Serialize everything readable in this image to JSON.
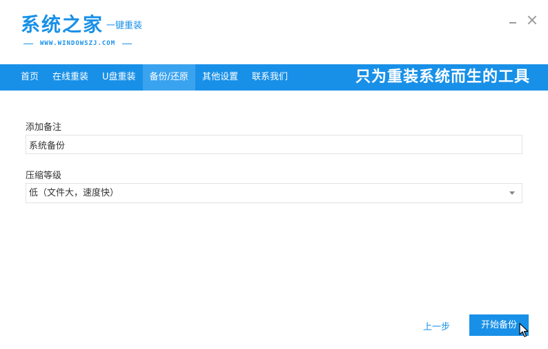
{
  "header": {
    "logo_main": "系统之家",
    "logo_sub": "一键重装",
    "logo_url": "WWW.WINDOWSZJ.COM"
  },
  "nav": {
    "items": [
      {
        "label": "首页"
      },
      {
        "label": "在线重装"
      },
      {
        "label": "U盘重装"
      },
      {
        "label": "备份/还原",
        "active": true
      },
      {
        "label": "其他设置"
      },
      {
        "label": "联系我们"
      }
    ],
    "slogan": "只为重装系统而生的工具"
  },
  "form": {
    "note_label": "添加备注",
    "note_value": "系统备份",
    "level_label": "压缩等级",
    "level_value": "低（文件大，速度快）"
  },
  "footer": {
    "prev_label": "上一步",
    "start_label": "开始备份"
  },
  "colors": {
    "accent": "#1890e8",
    "nav_active": "#3aa3f0"
  }
}
